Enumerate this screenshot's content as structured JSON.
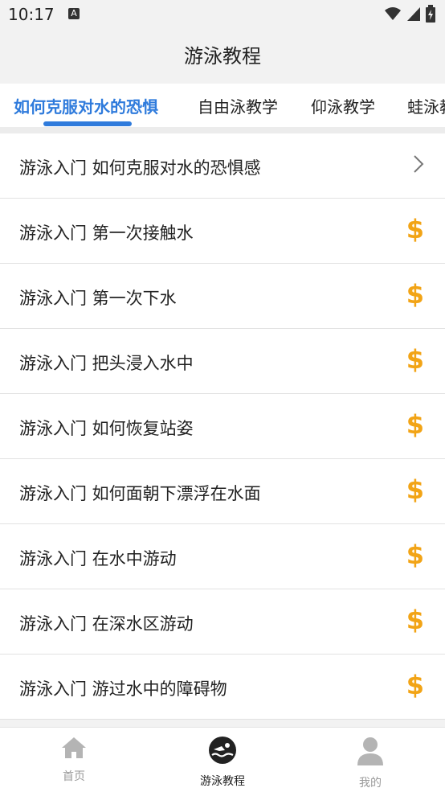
{
  "status_bar": {
    "time": "10:17",
    "notif_glyph": "A"
  },
  "header": {
    "title": "游泳教程"
  },
  "tabs": [
    {
      "label": "如何克服对水的恐惧",
      "active": true
    },
    {
      "label": "自由泳教学",
      "active": false
    },
    {
      "label": "仰泳教学",
      "active": false
    },
    {
      "label": "蛙泳教学",
      "active": false
    }
  ],
  "lessons": [
    {
      "title": "游泳入门 如何克服对水的恐惧感",
      "icon": "chevron-right-icon"
    },
    {
      "title": "游泳入门 第一次接触水",
      "icon": "dollar-icon"
    },
    {
      "title": "游泳入门 第一次下水",
      "icon": "dollar-icon"
    },
    {
      "title": "游泳入门 把头浸入水中",
      "icon": "dollar-icon"
    },
    {
      "title": "游泳入门 如何恢复站姿",
      "icon": "dollar-icon"
    },
    {
      "title": "游泳入门 如何面朝下漂浮在水面",
      "icon": "dollar-icon"
    },
    {
      "title": "游泳入门 在水中游动",
      "icon": "dollar-icon"
    },
    {
      "title": "游泳入门 在深水区游动",
      "icon": "dollar-icon"
    },
    {
      "title": "游泳入门 游过水中的障碍物",
      "icon": "dollar-icon"
    }
  ],
  "bottom_nav": [
    {
      "label": "首页",
      "icon": "home-icon",
      "active": false
    },
    {
      "label": "游泳教程",
      "icon": "swimmer-icon",
      "active": true
    },
    {
      "label": "我的",
      "icon": "user-icon",
      "active": false
    }
  ],
  "colors": {
    "accent": "#2f7bdc",
    "paid": "#f2a416",
    "background": "#f2f2f2"
  }
}
